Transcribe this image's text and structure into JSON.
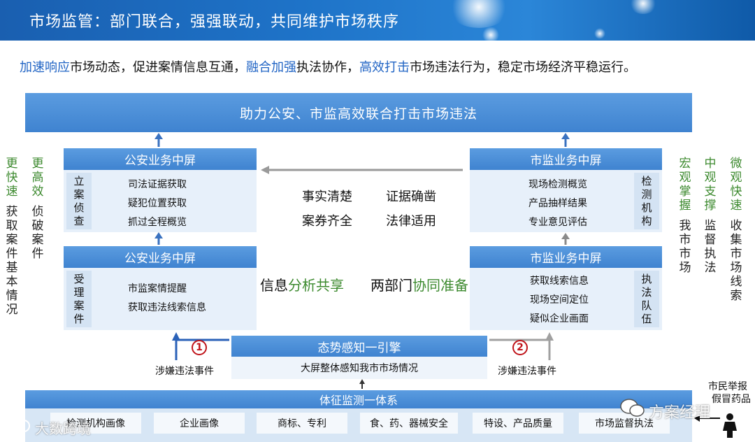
{
  "title": "市场监管：部门联合，强强联动，共同维护市场秩序",
  "subtitle": {
    "hl1": "加速响应",
    "t1": "市场动态，促进案情信息互通，",
    "hl2": "融合加强",
    "t2": "执法协作，",
    "hl3": "高效打击",
    "t3": "市场违法行为，稳定市场经济平稳运行。"
  },
  "top_banner": "助力公安、市监高效联合打击市场违法",
  "left_cols": [
    {
      "top": "更快速",
      "bottom": "获取案件基本情况"
    },
    {
      "top": "更高效",
      "bottom": "侦破案件"
    }
  ],
  "right_cols": [
    {
      "top": "宏观掌握",
      "bottom": "我市市场"
    },
    {
      "top": "中观支撑",
      "bottom": "监督执法"
    },
    {
      "top": "微观快速",
      "bottom": "收集市场线索"
    }
  ],
  "police_top": {
    "head": "公安业务中屏",
    "tag": "立案侦查",
    "items": [
      "司法证据获取",
      "疑犯位置获取",
      "抓过全程概览"
    ]
  },
  "police_bottom": {
    "head": "公安业务中屏",
    "tag": "受理案件",
    "items": [
      "市监案情提醒",
      "获取违法线索信息"
    ]
  },
  "market_top": {
    "head": "市监业务中屏",
    "tag": "检测机构",
    "items": [
      "现场检测概览",
      "产品抽样结果",
      "专业意见评估"
    ]
  },
  "market_bottom": {
    "head": "市监业务中屏",
    "tag": "执法队伍",
    "items": [
      "获取线索信息",
      "现场空间定位",
      "疑似企业画面"
    ]
  },
  "center": {
    "a": "事实清楚",
    "b": "证据确凿",
    "c": "案券齐全",
    "d": "法律适用",
    "e1": "信息",
    "e2": "分析共享",
    "f1": "两部门",
    "f2": "协同准备"
  },
  "engine": {
    "head": "态势感知一引擎",
    "sub": "大屏整体感知我市市场情况"
  },
  "flows": {
    "n1": "1",
    "n2": "2",
    "left_label": "涉嫌违法事件",
    "right_label": "涉嫌违法事件"
  },
  "citizen": {
    "line1": "市民举报",
    "line2": "假冒药品"
  },
  "base": {
    "head": "体征监测一体系",
    "cats": [
      "检测机构画像",
      "企业画像",
      "商标、专利",
      "食、药、器械安全",
      "特设、产品质量",
      "市场监督执法"
    ]
  },
  "watermarks": {
    "left": "大数跨境",
    "right": "方案经理"
  }
}
